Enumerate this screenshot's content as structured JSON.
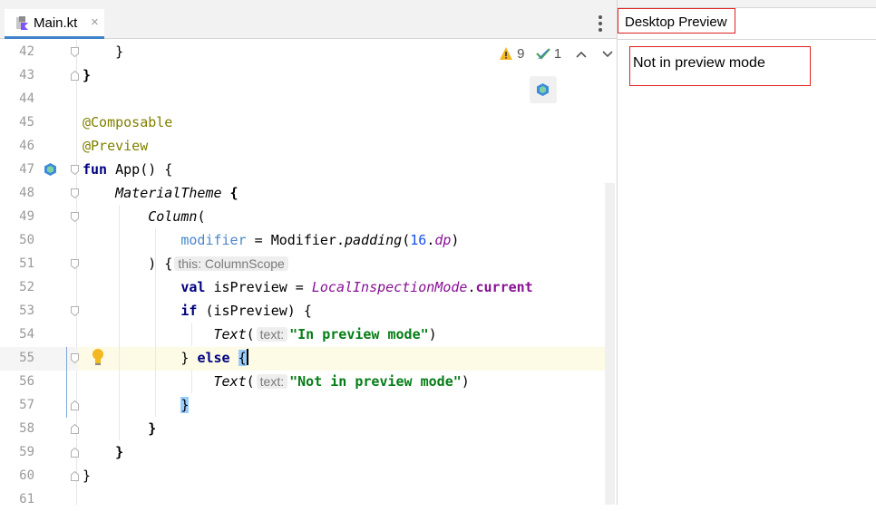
{
  "editor": {
    "tab": {
      "label": "Main.kt",
      "close": "×"
    },
    "inspections": {
      "warnings": "9",
      "checks": "1"
    },
    "lines": [
      {
        "n": "42"
      },
      {
        "n": "43"
      },
      {
        "n": "44"
      },
      {
        "n": "45"
      },
      {
        "n": "46"
      },
      {
        "n": "47"
      },
      {
        "n": "48"
      },
      {
        "n": "49"
      },
      {
        "n": "50"
      },
      {
        "n": "51"
      },
      {
        "n": "52"
      },
      {
        "n": "53"
      },
      {
        "n": "54"
      },
      {
        "n": "55"
      },
      {
        "n": "56"
      },
      {
        "n": "57"
      },
      {
        "n": "58"
      },
      {
        "n": "59"
      },
      {
        "n": "60"
      },
      {
        "n": "61"
      }
    ],
    "code": {
      "l42": "    }",
      "l43": "}",
      "l45": "@Composable",
      "l46": "@Preview",
      "l47_kw": "fun",
      "l47_rest": " App() {",
      "l48_fn": "MaterialTheme",
      "l48_rest": " {",
      "l49_fn": "Column",
      "l49_rest": "(",
      "l50_param": "modifier",
      "l50_eq": " = Modifier.",
      "l50_fn": "padding",
      "l50_open": "(",
      "l50_num": "16",
      "l50_dot": ".",
      "l50_dp": "dp",
      "l50_close": ")",
      "l51_code": ") {",
      "l51_hint": "this: ColumnScope",
      "l52_kw": "val",
      "l52_name": " isPreview = ",
      "l52_lim": "LocalInspectionMode",
      "l52_dot": ".",
      "l52_cur": "current",
      "l53_kw": "if",
      "l53_rest": " (isPreview) {",
      "l54_fn": "Text",
      "l54_open": "(",
      "l54_hint": "text:",
      "l54_str": "\"In preview mode\"",
      "l54_close": ")",
      "l55_brace": "}",
      "l55_kw": "else",
      "l55_open": "{",
      "l56_fn": "Text",
      "l56_open": "(",
      "l56_hint": "text:",
      "l56_str": "\"Not in preview mode\"",
      "l56_close": ")",
      "l57": "}",
      "l58": "}",
      "l59": "}",
      "l60": "}"
    }
  },
  "preview_panel": {
    "title": "Desktop Preview",
    "content_text": "Not in preview mode"
  },
  "colors": {
    "keyword": "#000080",
    "annotation": "#808000",
    "string": "#067d17",
    "number": "#1750eb",
    "highlight_border": "#e02020",
    "current_line": "#fdfbe6"
  }
}
